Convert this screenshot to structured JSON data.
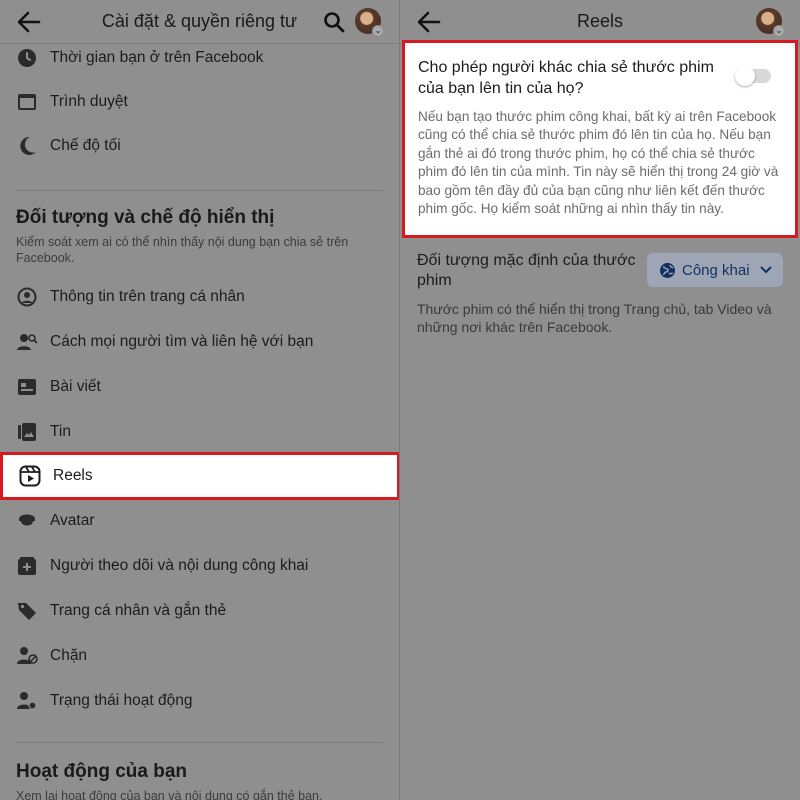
{
  "left": {
    "header": {
      "title": "Cài đặt & quyền riêng tư"
    },
    "top_items": [
      {
        "label": "Thời gian bạn ở trên Facebook",
        "icon": "clock-icon"
      },
      {
        "label": "Trình duyệt",
        "icon": "browser-icon"
      },
      {
        "label": "Chế độ tối",
        "icon": "moon-icon"
      }
    ],
    "section1": {
      "title": "Đối tượng và chế độ hiển thị",
      "description": "Kiểm soát xem ai có thể nhìn thấy nội dung bạn chia sẻ trên Facebook."
    },
    "items": [
      {
        "label": "Thông tin trên trang cá nhân",
        "icon": "profile-info-icon"
      },
      {
        "label": "Cách mọi người tìm và liên hệ với bạn",
        "icon": "find-contact-icon"
      },
      {
        "label": "Bài viết",
        "icon": "post-icon"
      },
      {
        "label": "Tin",
        "icon": "story-icon"
      },
      {
        "label": "Reels",
        "icon": "reels-icon"
      },
      {
        "label": "Avatar",
        "icon": "avatar-face-icon"
      },
      {
        "label": "Người theo dõi và nội dung công khai",
        "icon": "followers-icon"
      },
      {
        "label": "Trang cá nhân và gắn thẻ",
        "icon": "tag-icon"
      },
      {
        "label": "Chặn",
        "icon": "block-icon"
      },
      {
        "label": "Trạng thái hoạt động",
        "icon": "active-status-icon"
      }
    ],
    "section2": {
      "title": "Hoạt động của bạn",
      "description": "Xem lại hoạt động của bạn và nội dung có gắn thẻ bạn."
    }
  },
  "right": {
    "header": {
      "title": "Reels"
    },
    "share_setting": {
      "question": "Cho phép người khác chia sẻ thước phim của bạn lên tin của họ?",
      "enabled": false,
      "description": "Nếu bạn tạo thước phim công khai, bất kỳ ai trên Facebook cũng có thể chia sẻ thước phim đó lên tin của họ. Nếu bạn gắn thẻ ai đó trong thước phim, họ có thể chia sẻ thước phim đó lên tin của mình. Tin này sẽ hiển thị trong 24 giờ và bao gồm tên đầy đủ của bạn cũng như liên kết đến thước phim gốc. Họ kiểm soát những ai nhìn thấy tin này."
    },
    "default_audience": {
      "title": "Đối tượng mặc định của thước phim",
      "button_label": "Công khai",
      "description": "Thước phim có thể hiển thị trong Trang chủ, tab Video và những nơi khác trên Facebook."
    }
  },
  "colors": {
    "highlight_border": "#d71920",
    "dim_background": "#8f8f8f"
  }
}
